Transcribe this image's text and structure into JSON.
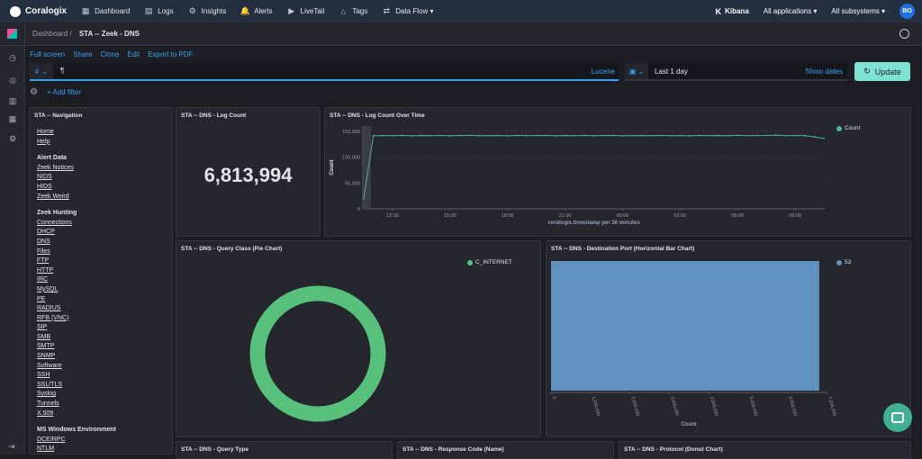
{
  "topbar": {
    "brand": "Coralogix",
    "nav": [
      {
        "label": "Dashboard",
        "icon": "dashboard-icon",
        "glyph": "▦"
      },
      {
        "label": "Logs",
        "icon": "logs-icon",
        "glyph": "▤"
      },
      {
        "label": "Insights",
        "icon": "insights-icon",
        "glyph": "⚙"
      },
      {
        "label": "Alerts",
        "icon": "bell-icon",
        "glyph": "🔔"
      },
      {
        "label": "LiveTail",
        "icon": "play-icon",
        "glyph": "▶"
      },
      {
        "label": "Tags",
        "icon": "tag-icon",
        "glyph": "⌂"
      },
      {
        "label": "Data Flow ▾",
        "icon": "data-flow-icon",
        "glyph": "⇄"
      }
    ],
    "kibana": "Kibana",
    "applications": "All applications",
    "subsystems": "All subsystems",
    "avatar": "BO"
  },
  "kibana_bar": {
    "crumb_root": "Dashboard",
    "crumb_current": "STA -- Zeek - DNS"
  },
  "menu": [
    "Full screen",
    "Share",
    "Clone",
    "Edit",
    "Export to PDF"
  ],
  "query": {
    "lang_symbol": "#",
    "text": "¶",
    "language": "Lucene"
  },
  "time": {
    "value": "Last 1 day",
    "show_dates": "Show dates",
    "update": "Update"
  },
  "filter": {
    "add": "+ Add filter"
  },
  "navigation_panel": {
    "title": "STA -- Navigation",
    "groups": [
      {
        "heading": "",
        "links": [
          "Home",
          "Help"
        ]
      },
      {
        "heading": "Alert Data",
        "links": [
          "Zeek Notices",
          "NIDS",
          "HIDS",
          "Zeek Weird"
        ]
      },
      {
        "heading": "Zeek Hunting",
        "links": [
          "Connections",
          "DHCP",
          "DNS",
          "Files",
          "FTP",
          "HTTP",
          "IRC",
          "MySQL",
          "PE",
          "RADIUS",
          "RFB (VNC)",
          "SIP",
          "SMB",
          "SMTP",
          "SNMP",
          "Software",
          "SSH",
          "SSL/TLS",
          "Syslog",
          "Tunnels",
          "X.509"
        ]
      },
      {
        "heading": "MS Windows Environment",
        "links": [
          "DCE/RPC",
          "NTLM"
        ]
      }
    ]
  },
  "log_count_panel": {
    "title": "STA -- DNS - Log Count",
    "value": "6,813,994"
  },
  "log_over_time_panel": {
    "title": "STA -- DNS - Log Count Over Time"
  },
  "query_class_panel": {
    "title": "STA -- DNS - Query Class (Pie Chart)"
  },
  "dest_port_panel": {
    "title": "STA -- DNS - Destination Port (Horizontal Bar Chart)"
  },
  "bottom_panels": [
    {
      "title": "STA -- DNS - Query Type"
    },
    {
      "title": "STA -- DNS - Response Code (Name)"
    },
    {
      "title": "STA -- DNS - Protocol (Donut Chart)"
    }
  ],
  "colors": {
    "accent": "#36a2ef",
    "line": "#54b399",
    "donut": "#57c17b",
    "bar": "#6092c0"
  },
  "chart_data": [
    {
      "type": "line",
      "ylabel": "Count",
      "xlabel": "coralogix.timestamp per 30 minutes",
      "x_ticks": [
        "12:00",
        "15:00",
        "18:00",
        "21:00",
        "00:00",
        "03:00",
        "06:00",
        "09:00"
      ],
      "y_ticks": [
        "0",
        "50,000",
        "100,000",
        "150,000"
      ],
      "ylim": [
        0,
        160000
      ],
      "legend": "top-right",
      "series": [
        {
          "name": "Count",
          "values": [
            20000,
            141000,
            141500,
            141200,
            141800,
            141000,
            141600,
            141300,
            141700,
            141100,
            141500,
            141900,
            141200,
            141400,
            141600,
            141000,
            141800,
            141300,
            141500,
            141700,
            141100,
            141600,
            141300,
            141800,
            141200,
            141500,
            141700,
            141000,
            141400,
            141600,
            141200,
            141800,
            141300,
            141500,
            141100,
            141700,
            141400,
            141600,
            141200,
            141900,
            141300,
            141500,
            141700,
            142500,
            141200,
            141600,
            141400,
            139000,
            136000
          ]
        }
      ]
    },
    {
      "type": "pie",
      "legend": "top-right",
      "categories": [
        "C_INTERNET"
      ],
      "values": [
        100
      ]
    },
    {
      "type": "bar",
      "orientation": "horizontal",
      "categories": [
        "53"
      ],
      "values": [
        6813994
      ],
      "xlabel": "Count",
      "x_ticks": [
        "0",
        "1,000,000",
        "2,000,000",
        "3,000,000",
        "4,000,000",
        "5,000,000",
        "6,000,000",
        "7,000,000"
      ],
      "xlim": [
        0,
        7000000
      ],
      "legend": "top-right"
    }
  ]
}
